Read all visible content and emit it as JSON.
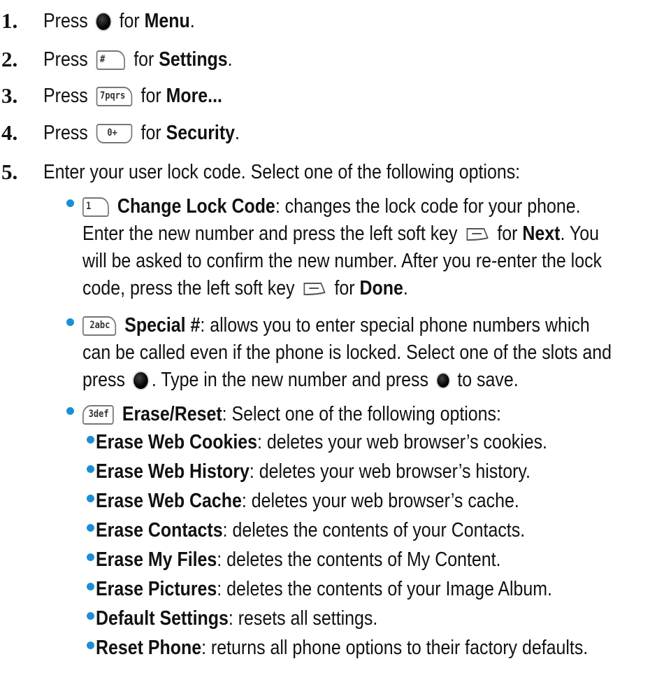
{
  "steps": [
    {
      "num": "1.",
      "press": "Press",
      "icon": "menu-ok-button",
      "for": "for",
      "target": "Menu",
      "end": "."
    },
    {
      "num": "2.",
      "press": "Press",
      "icon": "pound-key",
      "key_label": "#",
      "for": "for",
      "target": "Settings",
      "end": "."
    },
    {
      "num": "3.",
      "press": "Press",
      "icon": "seven-key",
      "key_label": "7pqrs",
      "for": "for",
      "target": "More...",
      "end": ""
    },
    {
      "num": "4.",
      "press": "Press",
      "icon": "zero-key",
      "key_label": "0+",
      "for": "for",
      "target": "Security",
      "end": "."
    },
    {
      "num": "5.",
      "text": "Enter your user lock code. Select one of the following options:"
    }
  ],
  "options": {
    "change_lock": {
      "key_label": "1",
      "title": "Change Lock Code",
      "line1": ": changes the lock code for your phone.",
      "line2a": "Enter the new number and press the left soft key",
      "line2b": "for",
      "line2c": "Next",
      "line2d": ". You",
      "line3": "will be asked to confirm the new number. After you re-enter the lock",
      "line4a": "code, press the left soft key",
      "line4b": "for",
      "line4c": "Done",
      "line4d": "."
    },
    "special": {
      "key_label": "2abc",
      "title": "Special #",
      "line1": ": allows you to enter special phone numbers which",
      "line2": "can be called even if the phone is locked. Select one of the slots and",
      "line3a": "press",
      "line3b": ". Type in the new number and press",
      "line3c": "to save."
    },
    "erase": {
      "key_label": "3def",
      "title": "Erase/Reset",
      "line1": ": Select one of the following options:",
      "items": [
        {
          "title": "Erase Web Cookies",
          "desc": ": deletes your web browser’s cookies."
        },
        {
          "title": "Erase Web History",
          "desc": ": deletes your web browser’s history."
        },
        {
          "title": "Erase Web Cache",
          "desc": ": deletes your web browser’s cache."
        },
        {
          "title": "Erase Contacts",
          "desc": ": deletes the contents of your Contacts."
        },
        {
          "title": "Erase My Files",
          "desc": ": deletes the contents of My Content."
        },
        {
          "title": "Erase Pictures",
          "desc": ": deletes the contents of your Image Album."
        },
        {
          "title": "Default Settings",
          "desc": ": resets all settings."
        },
        {
          "title": "Reset Phone",
          "desc": ": returns all phone options to their factory defaults."
        }
      ]
    }
  },
  "colors": {
    "bullet": "#1b8fd6",
    "text": "#111111"
  }
}
